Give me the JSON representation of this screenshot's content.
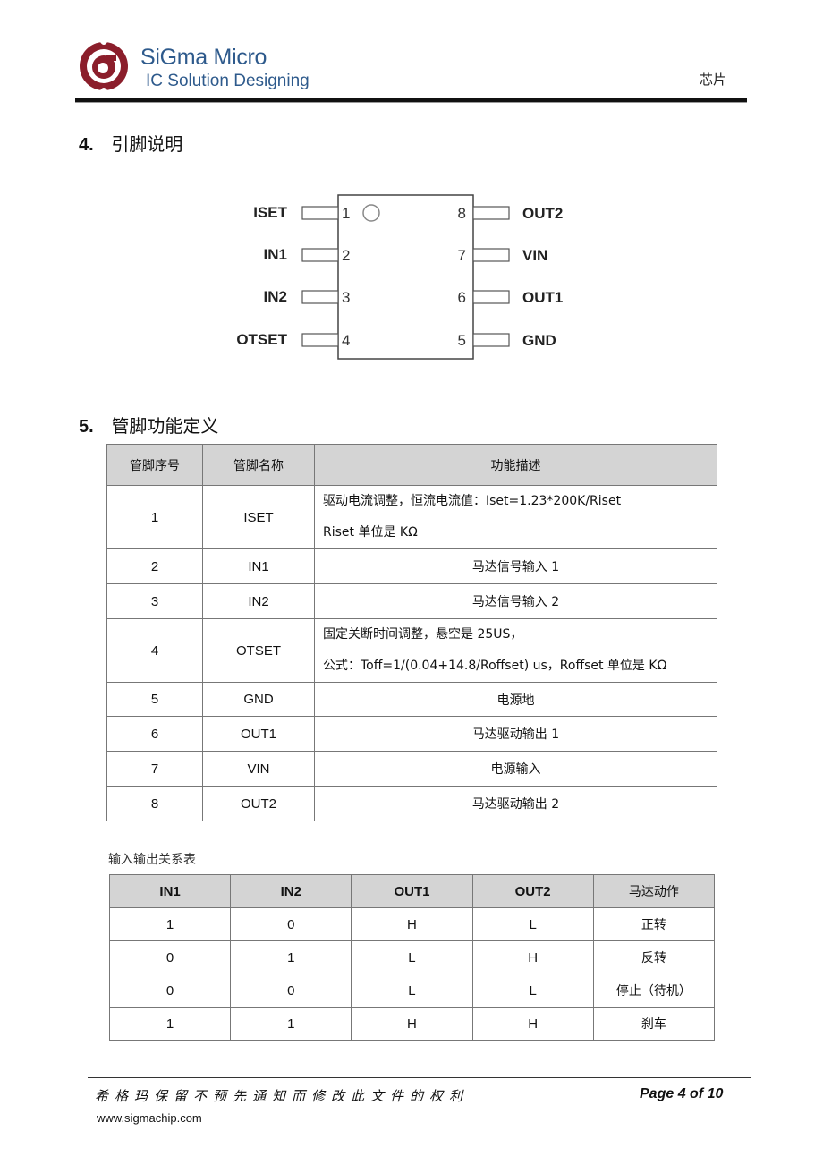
{
  "header": {
    "brand_name": "SiGma Micro",
    "brand_tagline": "IC Solution Designing",
    "logo_icon": "sigma-circle-logo",
    "right_label": "芯片",
    "colors": {
      "brand_blue": "#2e5a8c",
      "logo_red": "#8b1e2b"
    }
  },
  "sections": {
    "pin_description": {
      "number": "4.",
      "title": "引脚说明"
    },
    "pin_function": {
      "number": "5.",
      "title": "管脚功能定义"
    }
  },
  "pinout": {
    "left_pins": [
      {
        "num": "1",
        "name": "ISET"
      },
      {
        "num": "2",
        "name": "IN1"
      },
      {
        "num": "3",
        "name": "IN2"
      },
      {
        "num": "4",
        "name": "OTSET"
      }
    ],
    "right_pins": [
      {
        "num": "8",
        "name": "OUT2"
      },
      {
        "num": "7",
        "name": "VIN"
      },
      {
        "num": "6",
        "name": "OUT1"
      },
      {
        "num": "5",
        "name": "GND"
      }
    ]
  },
  "pin_table": {
    "headers": [
      "管脚序号",
      "管脚名称",
      "功能描述"
    ],
    "rows": [
      {
        "num": "1",
        "name": "ISET",
        "desc_lines": [
          "驱动电流调整，恒流电流值：Iset=1.23*200K/Riset",
          "Riset 单位是 KΩ"
        ]
      },
      {
        "num": "2",
        "name": "IN1",
        "desc": "马达信号输入 1"
      },
      {
        "num": "3",
        "name": "IN2",
        "desc": "马达信号输入 2"
      },
      {
        "num": "4",
        "name": "OTSET",
        "desc_lines": [
          "固定关断时间调整，悬空是 25US，",
          "公式：Toff=1/(0.04+14.8/Roffset) us，Roffset 单位是 KΩ"
        ]
      },
      {
        "num": "5",
        "name": "GND",
        "desc": "电源地"
      },
      {
        "num": "6",
        "name": "OUT1",
        "desc": "马达驱动输出 1"
      },
      {
        "num": "7",
        "name": "VIN",
        "desc": "电源输入"
      },
      {
        "num": "8",
        "name": "OUT2",
        "desc": "马达驱动输出 2"
      }
    ]
  },
  "io_table": {
    "caption": "输入输出关系表",
    "headers": [
      "IN1",
      "IN2",
      "OUT1",
      "OUT2",
      "马达动作"
    ],
    "rows": [
      [
        "1",
        "0",
        "H",
        "L",
        "正转"
      ],
      [
        "0",
        "1",
        "L",
        "H",
        "反转"
      ],
      [
        "0",
        "0",
        "L",
        "L",
        "停止（待机）"
      ],
      [
        "1",
        "1",
        "H",
        "H",
        "刹车"
      ]
    ]
  },
  "footer": {
    "notice": "希格玛保留不预先通知而修改此文件的权利",
    "page_label": "Page 4 of 10",
    "url": "www.sigmachip.com"
  }
}
